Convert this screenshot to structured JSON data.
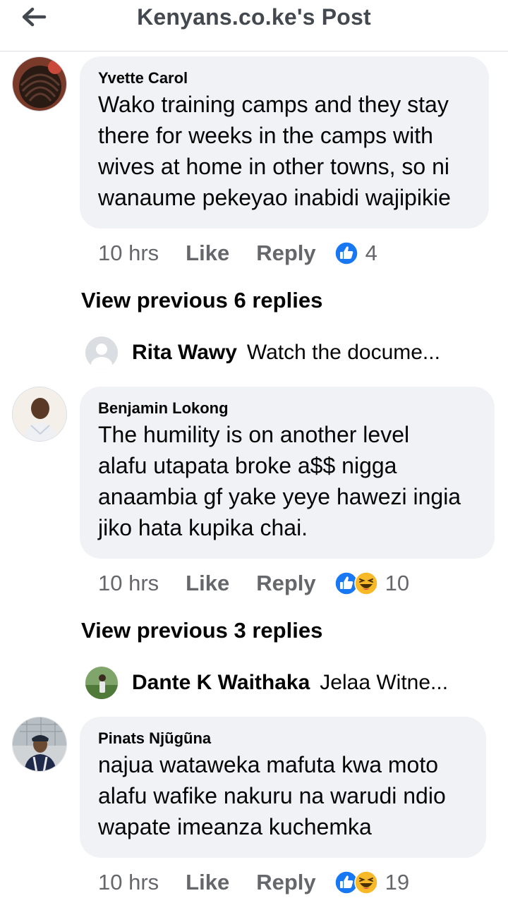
{
  "header": {
    "title": "Kenyans.co.ke's Post",
    "back_icon": "arrow-left-icon"
  },
  "colors": {
    "bubble": "#f0f2f5",
    "meta_text": "#65676b",
    "like_blue": "#1877f2",
    "haha_yellow": "#f7b928"
  },
  "comments": [
    {
      "author": "Yvette Carol",
      "lines": [
        "Wako training camps and they stay",
        "there for weeks in the camps with",
        "wives at home in other towns, so ni",
        "wanaume pekeyao inabidi wajipikie"
      ],
      "time": "10 hrs",
      "like_label": "Like",
      "reply_label": "Reply",
      "reactions": [
        "like-icon"
      ],
      "reaction_count": "4",
      "view_previous": "View previous 6 replies",
      "reply_preview": {
        "name": "Rita Wawy",
        "text": "Watch the docume..."
      }
    },
    {
      "author": "Benjamin Lokong",
      "lines": [
        "The humility is on another level",
        "alafu utapata broke a$$ nigga",
        "anaambia gf yake yeye hawezi ingia",
        "jiko hata kupika chai."
      ],
      "time": "10 hrs",
      "like_label": "Like",
      "reply_label": "Reply",
      "reactions": [
        "like-icon",
        "haha-icon"
      ],
      "reaction_count": "10",
      "view_previous": "View previous 3 replies",
      "reply_preview": {
        "name": "Dante K Waithaka",
        "text": "Jelaa Witne..."
      }
    },
    {
      "author": "Pinats Njũgũna",
      "lines": [
        "najua wataweka mafuta kwa moto",
        "alafu wafike nakuru na warudi ndio",
        "wapate imeanza kuchemka"
      ],
      "time": "10 hrs",
      "like_label": "Like",
      "reply_label": "Reply",
      "reactions": [
        "like-icon",
        "haha-icon"
      ],
      "reaction_count": "19"
    }
  ]
}
